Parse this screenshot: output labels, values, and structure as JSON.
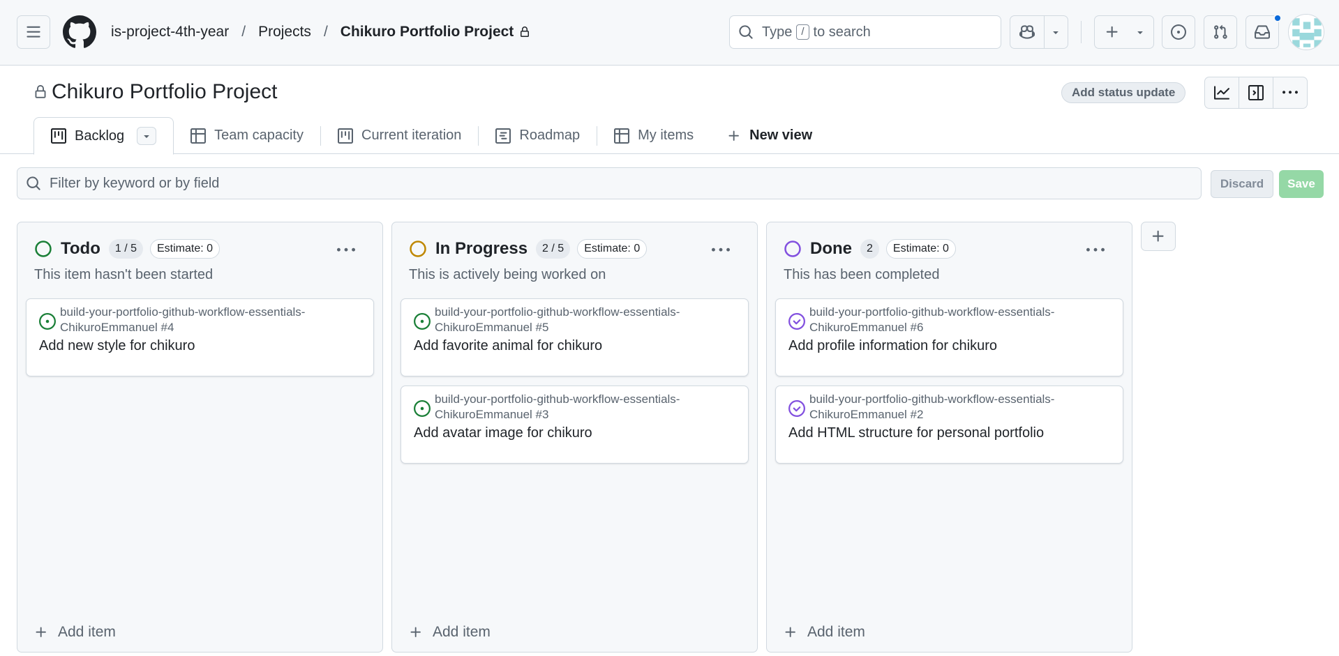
{
  "header": {
    "breadcrumbs": [
      "is-project-4th-year",
      "Projects",
      "Chikuro Portfolio Project"
    ],
    "breadcrumb_sep": "/",
    "search": {
      "prefix": "Type",
      "key": "/",
      "suffix": "to search"
    },
    "icons": [
      "menu-icon",
      "github-logo",
      "lock-icon",
      "search-icon",
      "copilot-icon",
      "triangle-down-icon",
      "plus-icon",
      "issue-opened-icon",
      "git-pull-request-icon",
      "inbox-icon",
      "avatar"
    ],
    "notification_dot_color": "#0969da"
  },
  "project": {
    "title": "Chikuro Portfolio Project",
    "status_button": "Add status update",
    "actions": [
      "graph-icon",
      "sidebar-panel-icon",
      "kebab-horizontal-icon"
    ]
  },
  "tabs": [
    {
      "label": "Backlog",
      "icon": "project-board-icon",
      "active": true
    },
    {
      "label": "Team capacity",
      "icon": "table-icon",
      "active": false
    },
    {
      "label": "Current iteration",
      "icon": "project-board-icon",
      "active": false
    },
    {
      "label": "Roadmap",
      "icon": "roadmap-icon",
      "active": false
    },
    {
      "label": "My items",
      "icon": "table-icon",
      "active": false
    },
    {
      "label": "New view",
      "icon": "plus-icon",
      "active": false
    }
  ],
  "filter": {
    "placeholder": "Filter by keyword or by field",
    "discard": "Discard",
    "save": "Save"
  },
  "columns": [
    {
      "title": "Todo",
      "count": "1 / 5",
      "estimate": "Estimate: 0",
      "description": "This item hasn't been started",
      "status_color": "#1a7f37",
      "add_item": "Add item",
      "cards": [
        {
          "repo": "build-your-portfolio-github-workflow-essentials-ChikuroEmmanuel #4",
          "title": "Add new style for chikuro",
          "state": "open"
        }
      ]
    },
    {
      "title": "In Progress",
      "count": "2 / 5",
      "estimate": "Estimate: 0",
      "description": "This is actively being worked on",
      "status_color": "#bf8700",
      "add_item": "Add item",
      "cards": [
        {
          "repo": "build-your-portfolio-github-workflow-essentials-ChikuroEmmanuel #5",
          "title": "Add favorite animal for chikuro",
          "state": "open"
        },
        {
          "repo": "build-your-portfolio-github-workflow-essentials-ChikuroEmmanuel #3",
          "title": "Add avatar image for chikuro",
          "state": "open"
        }
      ]
    },
    {
      "title": "Done",
      "count": "2",
      "estimate": "Estimate: 0",
      "description": "This has been completed",
      "status_color": "#8250df",
      "add_item": "Add item",
      "cards": [
        {
          "repo": "build-your-portfolio-github-workflow-essentials-ChikuroEmmanuel #6",
          "title": "Add profile information for chikuro",
          "state": "closed"
        },
        {
          "repo": "build-your-portfolio-github-workflow-essentials-ChikuroEmmanuel #2",
          "title": "Add HTML structure for personal portfolio",
          "state": "closed"
        }
      ]
    }
  ],
  "colors": {
    "open_issue": "#1a7f37",
    "closed_issue": "#8250df",
    "save_disabled": "#95d8a6"
  }
}
